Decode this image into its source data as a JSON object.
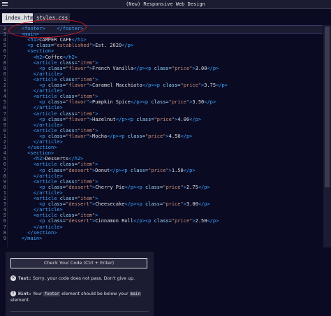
{
  "window": {
    "title": "(New) Responsive Web Design"
  },
  "tabs": [
    {
      "label": "index.html",
      "active": true
    },
    {
      "label": "styles.css",
      "active": false
    }
  ],
  "code_lines": [
    {
      "n": "2",
      "parts": [
        [
          "x",
          "    "
        ],
        [
          "t",
          "<footer>"
        ],
        [
          "x",
          "    "
        ],
        [
          "t",
          "</footer>"
        ]
      ]
    },
    {
      "n": "3",
      "parts": [
        [
          "x",
          "    "
        ],
        [
          "t",
          "<main>"
        ]
      ]
    },
    {
      "n": "4",
      "parts": [
        [
          "x",
          "      "
        ],
        [
          "t",
          "<h1>"
        ],
        [
          "x",
          "CAMPER CAFE"
        ],
        [
          "t",
          "</h1>"
        ]
      ]
    },
    {
      "n": "5",
      "parts": [
        [
          "x",
          "      "
        ],
        [
          "t",
          "<p "
        ],
        [
          "a",
          "class="
        ],
        [
          "s",
          "\"established\""
        ],
        [
          "t",
          ">"
        ],
        [
          "x",
          "Est. 2020"
        ],
        [
          "t",
          "</p>"
        ]
      ]
    },
    {
      "n": "6",
      "parts": [
        [
          "x",
          "      "
        ],
        [
          "t",
          "<section>"
        ]
      ]
    },
    {
      "n": "7",
      "parts": [
        [
          "x",
          "        "
        ],
        [
          "t",
          "<h2>"
        ],
        [
          "x",
          "Coffee"
        ],
        [
          "t",
          "</h2>"
        ]
      ]
    },
    {
      "n": "8",
      "parts": [
        [
          "x",
          "        "
        ],
        [
          "t",
          "<article "
        ],
        [
          "a",
          "class="
        ],
        [
          "s",
          "\"item\""
        ],
        [
          "t",
          ">"
        ]
      ]
    },
    {
      "n": "9",
      "parts": [
        [
          "x",
          "          "
        ],
        [
          "t",
          "<p "
        ],
        [
          "a",
          "class="
        ],
        [
          "s",
          "\"flavor\""
        ],
        [
          "t",
          ">"
        ],
        [
          "x",
          "French Vanilla"
        ],
        [
          "t",
          "</p><p "
        ],
        [
          "a",
          "class="
        ],
        [
          "s",
          "\"price\""
        ],
        [
          "t",
          ">"
        ],
        [
          "x",
          "3.00"
        ],
        [
          "t",
          "</p>"
        ]
      ]
    },
    {
      "n": "0",
      "parts": [
        [
          "x",
          "        "
        ],
        [
          "t",
          "</article>"
        ]
      ]
    },
    {
      "n": "1",
      "parts": [
        [
          "x",
          "        "
        ],
        [
          "t",
          "<article "
        ],
        [
          "a",
          "class="
        ],
        [
          "s",
          "\"item\""
        ],
        [
          "t",
          ">"
        ]
      ]
    },
    {
      "n": "2",
      "parts": [
        [
          "x",
          "          "
        ],
        [
          "t",
          "<p "
        ],
        [
          "a",
          "class="
        ],
        [
          "s",
          "\"flavor\""
        ],
        [
          "t",
          ">"
        ],
        [
          "x",
          "Caramel Macchiato"
        ],
        [
          "t",
          "</p><p "
        ],
        [
          "a",
          "class="
        ],
        [
          "s",
          "\"price\""
        ],
        [
          "t",
          ">"
        ],
        [
          "x",
          "3.75"
        ],
        [
          "t",
          "</p>"
        ]
      ]
    },
    {
      "n": "3",
      "parts": [
        [
          "x",
          "        "
        ],
        [
          "t",
          "</article>"
        ]
      ]
    },
    {
      "n": "4",
      "parts": [
        [
          "x",
          "        "
        ],
        [
          "t",
          "<article "
        ],
        [
          "a",
          "class="
        ],
        [
          "s",
          "\"item\""
        ],
        [
          "t",
          ">"
        ]
      ]
    },
    {
      "n": "5",
      "parts": [
        [
          "x",
          "          "
        ],
        [
          "t",
          "<p "
        ],
        [
          "a",
          "class="
        ],
        [
          "s",
          "\"flavor\""
        ],
        [
          "t",
          ">"
        ],
        [
          "x",
          "Pumpkin Spice"
        ],
        [
          "t",
          "</p><p "
        ],
        [
          "a",
          "class="
        ],
        [
          "s",
          "\"price\""
        ],
        [
          "t",
          ">"
        ],
        [
          "x",
          "3.50"
        ],
        [
          "t",
          "</p>"
        ]
      ]
    },
    {
      "n": "6",
      "parts": [
        [
          "x",
          "        "
        ],
        [
          "t",
          "</article>"
        ]
      ]
    },
    {
      "n": "7",
      "parts": [
        [
          "x",
          "        "
        ],
        [
          "t",
          "<article "
        ],
        [
          "a",
          "class="
        ],
        [
          "s",
          "\"item\""
        ],
        [
          "t",
          ">"
        ]
      ]
    },
    {
      "n": "8",
      "parts": [
        [
          "x",
          "          "
        ],
        [
          "t",
          "<p "
        ],
        [
          "a",
          "class="
        ],
        [
          "s",
          "\"flavor\""
        ],
        [
          "t",
          ">"
        ],
        [
          "x",
          "Hazelnut"
        ],
        [
          "t",
          "</p><p "
        ],
        [
          "a",
          "class="
        ],
        [
          "s",
          "\"price\""
        ],
        [
          "t",
          ">"
        ],
        [
          "x",
          "4.00"
        ],
        [
          "t",
          "</p>"
        ]
      ]
    },
    {
      "n": "9",
      "parts": [
        [
          "x",
          "        "
        ],
        [
          "t",
          "</article>"
        ]
      ]
    },
    {
      "n": "0",
      "parts": [
        [
          "x",
          "        "
        ],
        [
          "t",
          "<article "
        ],
        [
          "a",
          "class="
        ],
        [
          "s",
          "\"item\""
        ],
        [
          "t",
          ">"
        ]
      ]
    },
    {
      "n": "1",
      "parts": [
        [
          "x",
          "          "
        ],
        [
          "t",
          "<p "
        ],
        [
          "a",
          "class="
        ],
        [
          "s",
          "\"flavor\""
        ],
        [
          "t",
          ">"
        ],
        [
          "x",
          "Mocha"
        ],
        [
          "t",
          "</p><p "
        ],
        [
          "a",
          "class="
        ],
        [
          "s",
          "\"price\""
        ],
        [
          "t",
          ">"
        ],
        [
          "x",
          "4.50"
        ],
        [
          "t",
          "</p>"
        ]
      ]
    },
    {
      "n": "2",
      "parts": [
        [
          "x",
          "        "
        ],
        [
          "t",
          "</article>"
        ]
      ]
    },
    {
      "n": "3",
      "parts": [
        [
          "x",
          "      "
        ],
        [
          "t",
          "</section>"
        ]
      ]
    },
    {
      "n": "4",
      "parts": [
        [
          "x",
          "      "
        ],
        [
          "t",
          "<section>"
        ]
      ]
    },
    {
      "n": "5",
      "parts": [
        [
          "x",
          "        "
        ],
        [
          "t",
          "<h2>"
        ],
        [
          "x",
          "Desserts"
        ],
        [
          "t",
          "</h2>"
        ]
      ]
    },
    {
      "n": "6",
      "parts": [
        [
          "x",
          "        "
        ],
        [
          "t",
          "<article "
        ],
        [
          "a",
          "class="
        ],
        [
          "s",
          "\"item\""
        ],
        [
          "t",
          ">"
        ]
      ]
    },
    {
      "n": "7",
      "parts": [
        [
          "x",
          "          "
        ],
        [
          "t",
          "<p "
        ],
        [
          "a",
          "class="
        ],
        [
          "s",
          "\"dessert\""
        ],
        [
          "t",
          ">"
        ],
        [
          "x",
          "Donut"
        ],
        [
          "t",
          "</p><p "
        ],
        [
          "a",
          "class="
        ],
        [
          "s",
          "\"price\""
        ],
        [
          "t",
          ">"
        ],
        [
          "x",
          "1.50"
        ],
        [
          "t",
          "</p>"
        ]
      ]
    },
    {
      "n": "8",
      "parts": [
        [
          "x",
          "        "
        ],
        [
          "t",
          "</article>"
        ]
      ]
    },
    {
      "n": "9",
      "parts": [
        [
          "x",
          "        "
        ],
        [
          "t",
          "<article "
        ],
        [
          "a",
          "class="
        ],
        [
          "s",
          "\"item\""
        ],
        [
          "t",
          ">"
        ]
      ]
    },
    {
      "n": "0",
      "parts": [
        [
          "x",
          "          "
        ],
        [
          "t",
          "<p "
        ],
        [
          "a",
          "class="
        ],
        [
          "s",
          "\"dessert\""
        ],
        [
          "t",
          ">"
        ],
        [
          "x",
          "Cherry Pie"
        ],
        [
          "t",
          "</p><p "
        ],
        [
          "a",
          "class="
        ],
        [
          "s",
          "\"price\""
        ],
        [
          "t",
          ">"
        ],
        [
          "x",
          "2.75"
        ],
        [
          "t",
          "</p>"
        ]
      ]
    },
    {
      "n": "1",
      "parts": [
        [
          "x",
          "        "
        ],
        [
          "t",
          "</article>"
        ]
      ]
    },
    {
      "n": "2",
      "parts": [
        [
          "x",
          "        "
        ],
        [
          "t",
          "<article "
        ],
        [
          "a",
          "class="
        ],
        [
          "s",
          "\"item\""
        ],
        [
          "t",
          ">"
        ]
      ]
    },
    {
      "n": "3",
      "parts": [
        [
          "x",
          "          "
        ],
        [
          "t",
          "<p "
        ],
        [
          "a",
          "class="
        ],
        [
          "s",
          "\"dessert\""
        ],
        [
          "t",
          ">"
        ],
        [
          "x",
          "Cheesecake"
        ],
        [
          "t",
          "</p><p "
        ],
        [
          "a",
          "class="
        ],
        [
          "s",
          "\"price\""
        ],
        [
          "t",
          ">"
        ],
        [
          "x",
          "3.00"
        ],
        [
          "t",
          "</p>"
        ]
      ]
    },
    {
      "n": "4",
      "parts": [
        [
          "x",
          "        "
        ],
        [
          "t",
          "</article>"
        ]
      ]
    },
    {
      "n": "5",
      "parts": [
        [
          "x",
          "        "
        ],
        [
          "t",
          "<article "
        ],
        [
          "a",
          "class="
        ],
        [
          "s",
          "\"item\""
        ],
        [
          "t",
          ">"
        ]
      ]
    },
    {
      "n": "6",
      "parts": [
        [
          "x",
          "          "
        ],
        [
          "t",
          "<p "
        ],
        [
          "a",
          "class="
        ],
        [
          "s",
          "\"dessert\""
        ],
        [
          "t",
          ">"
        ],
        [
          "x",
          "Cinnamon Roll"
        ],
        [
          "t",
          "</p><p "
        ],
        [
          "a",
          "class="
        ],
        [
          "s",
          "\"price\""
        ],
        [
          "t",
          ">"
        ],
        [
          "x",
          "2.50"
        ],
        [
          "t",
          "</p>"
        ]
      ]
    },
    {
      "n": "7",
      "parts": [
        [
          "x",
          "        "
        ],
        [
          "t",
          "</article>"
        ]
      ]
    },
    {
      "n": "8",
      "parts": [
        [
          "x",
          "      "
        ],
        [
          "t",
          "</section>"
        ]
      ]
    },
    {
      "n": "9",
      "parts": [
        [
          "x",
          "    "
        ],
        [
          "t",
          "</main>"
        ]
      ]
    }
  ],
  "panel": {
    "check_button": "Check Your Code (Ctrl + Enter)",
    "test_label": "Test:",
    "test_text": "Sorry, your code does not pass. Don't give up.",
    "hint_label": "Hint:",
    "hint_before": "Your ",
    "hint_code1": "footer",
    "hint_middle": " element should be below your ",
    "hint_code2": "main",
    "hint_after": "element."
  },
  "colors": {
    "background": "#0a0a23",
    "tag": "#3ea6ff",
    "annotation": "#d81b1b"
  },
  "icons": [
    "menu-icon",
    "close-circle-icon",
    "lightbulb-icon"
  ]
}
